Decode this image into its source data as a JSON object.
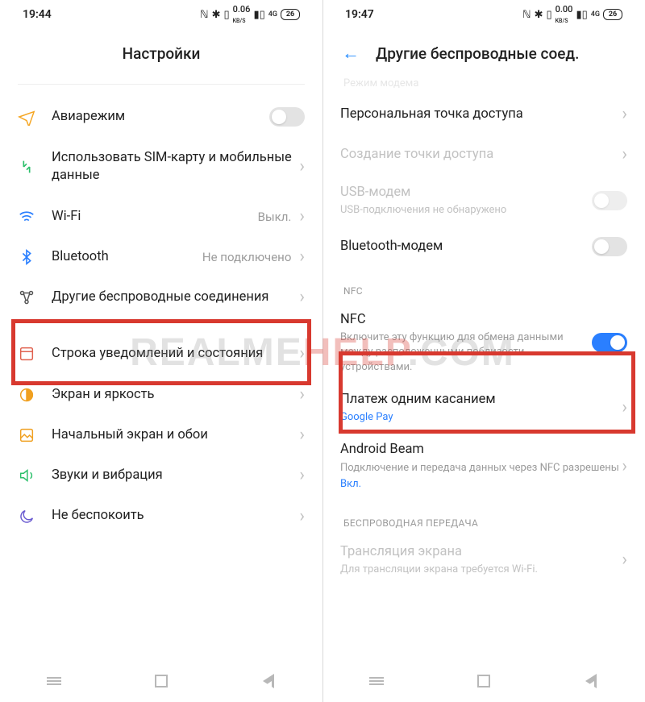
{
  "watermark": {
    "left": "REALME",
    "mid": "HELP",
    "right": ".COM"
  },
  "left": {
    "status": {
      "time": "19:44",
      "battery": "26",
      "net": "0.06",
      "netUnit": "KB/S"
    },
    "header": {
      "title": "Настройки"
    },
    "rows": {
      "airplane": {
        "title": "Авиарежим"
      },
      "sim": {
        "title": "Использовать SIM-карту и мобильные данные"
      },
      "wifi": {
        "title": "Wi-Fi",
        "value": "Выкл."
      },
      "bluetooth": {
        "title": "Bluetooth",
        "value": "Не подключено"
      },
      "other_wireless": {
        "title": "Другие беспроводные соединения"
      },
      "notif_bar": {
        "title": "Строка уведомлений и состояния"
      },
      "display": {
        "title": "Экран и яркость"
      },
      "home": {
        "title": "Начальный экран и обои"
      },
      "sound": {
        "title": "Звуки и вибрация"
      },
      "dnd": {
        "title": "Не беспокоить"
      }
    }
  },
  "right": {
    "status": {
      "time": "19:47",
      "battery": "26",
      "net": "0.00",
      "netUnit": "KB/S"
    },
    "header": {
      "title": "Другие беспроводные соед."
    },
    "cut_top": "Режим модема",
    "rows": {
      "hotspot": {
        "title": "Персональная точка доступа"
      },
      "hotspot_create": {
        "title": "Создание точки доступа"
      },
      "usb_modem": {
        "title": "USB-модем",
        "sub": "USB-подключения не обнаружено"
      },
      "bt_modem": {
        "title": "Bluetooth-модем"
      },
      "section_nfc": "NFC",
      "nfc": {
        "title": "NFC",
        "sub": "Включите эту функцию для обмена данными между расположенными поблизости устройствами."
      },
      "tap_pay": {
        "title": "Платеж одним касанием",
        "sub": "Google Pay"
      },
      "android_beam": {
        "title": "Android Beam",
        "sub": "Подключение и передача данных через NFC разрешены",
        "status": "Вкл."
      },
      "section_cast": "БЕСПРОВОДНАЯ ПЕРЕДАЧА",
      "cast": {
        "title": "Трансляция экрана",
        "sub": "Для трансляции экрана требуется Wi-Fi."
      }
    }
  }
}
